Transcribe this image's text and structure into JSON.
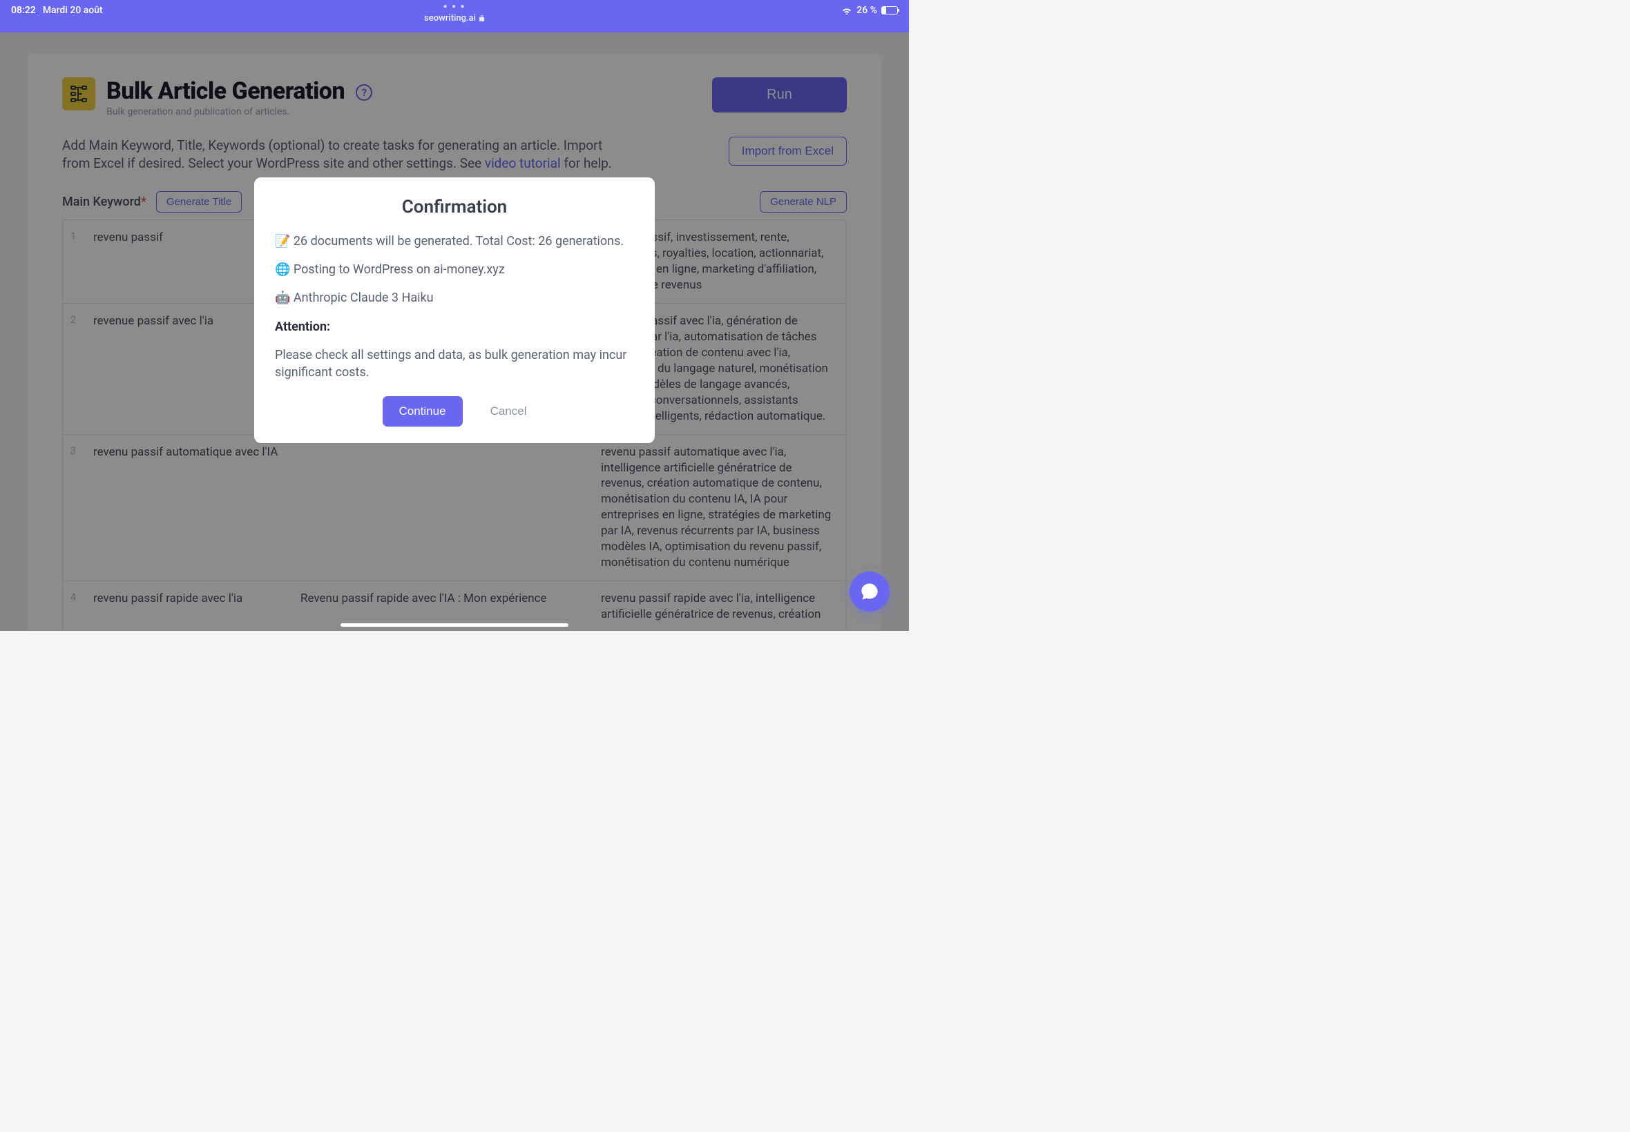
{
  "statusbar": {
    "time": "08:22",
    "date": "Mardi 20 août",
    "url": "seowriting.ai",
    "battery_pct": "26 %",
    "battery_level": 26
  },
  "header": {
    "title": "Bulk Article Generation",
    "subtitle": "Bulk generation and publication of articles.",
    "run_label": "Run"
  },
  "instructions": {
    "text_before_link": "Add Main Keyword, Title, Keywords (optional) to create tasks for generating an article. Import from Excel if desired. Select your WordPress site and other settings. See ",
    "link_text": "video tutorial",
    "text_after_link": " for help.",
    "import_label": "Import from Excel"
  },
  "table_header": {
    "main_keyword_label": "Main Keyword",
    "generate_title_label": "Generate Title",
    "generate_nlp_label": "Generate NLP"
  },
  "rows": [
    {
      "num": "1",
      "keyword": "revenu passif",
      "title": "",
      "keywords": "revenu passif, investissement, rente, dividendes, royalties, location, actionnariat, entreprise en ligne, marketing d'affiliation, sources de revenus"
    },
    {
      "num": "2",
      "keyword": "revenue passif avec l'ia",
      "title": "",
      "keywords": "revenue passif avec l'ia, génération de revenus par l'ia, automatisation de tâches par l'ia, création de contenu avec l'ia, traitement du langage naturel, monétisation de l'ia, modèles de langage avancés, chatbots conversationnels, assistants virtuels intelligents, rédaction automatique."
    },
    {
      "num": "3",
      "keyword": "revenu passif automatique avec l'IA",
      "title": "",
      "keywords": "revenu passif automatique avec l'ia, intelligence artificielle génératrice de revenus, création automatique de contenu, monétisation du contenu IA, IA pour entreprises en ligne, stratégies de marketing par IA, revenus récurrents par IA, business modèles IA, optimisation du revenu passif, monétisation du contenu numérique"
    },
    {
      "num": "4",
      "keyword": "revenu passif rapide avec l'ia",
      "title": "Revenu passif rapide avec l'IA : Mon expérience",
      "keywords": "revenu passif rapide avec l'ia, intelligence artificielle génératrice de revenus, création"
    }
  ],
  "modal": {
    "title": "Confirmation",
    "line1": "📝 26 documents will be generated. Total Cost: 26 generations.",
    "line2": "🌐 Posting to WordPress on ai-money.xyz",
    "line3": "🤖 Anthropic Claude 3 Haiku",
    "attention_label": "Attention:",
    "warning": "Please check all settings and data, as bulk generation may incur significant costs.",
    "continue_label": "Continue",
    "cancel_label": "Cancel"
  }
}
